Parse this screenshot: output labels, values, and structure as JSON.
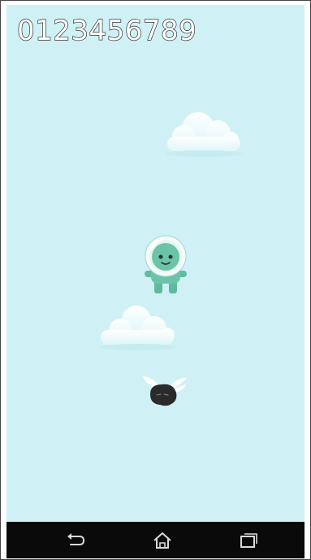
{
  "hud": {
    "score": "0123456789"
  },
  "sprites": {
    "player": "alien-astronaut-character",
    "enemy": "black-winged-blob",
    "clouds": [
      "cloud",
      "cloud"
    ]
  },
  "navigation": {
    "buttons": [
      "back-icon",
      "home-icon",
      "recent-apps-icon"
    ]
  },
  "colors": {
    "sky": "#cff1f5",
    "player": "#6cc4a8",
    "enemy": "#2a2a2a",
    "navbar": "#0a0a0a"
  }
}
